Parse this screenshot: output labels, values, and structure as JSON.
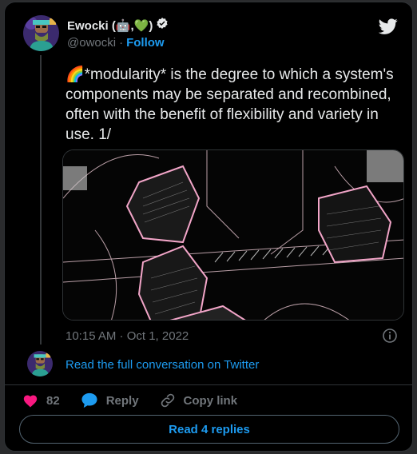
{
  "tweet": {
    "author": {
      "display_name": "Ewocki (🤖,💚)",
      "verified_icon": "verified-badge-icon",
      "handle": "@owocki",
      "separator": "·",
      "follow_label": "Follow"
    },
    "text": "🌈*modularity* is the degree to which a system's components may be separated and recombined, often with the benefit of flexibility and variety in use. 1/",
    "timestamp": "10:15 AM · Oct 1, 2022",
    "read_conversation": "Read the full conversation on Twitter",
    "likes_count": "82",
    "reply_label": "Reply",
    "copy_link_label": "Copy link",
    "read_replies_label": "Read 4 replies"
  },
  "colors": {
    "accent": "#1d9bf0",
    "like": "#f91880",
    "muted": "#71767b",
    "background": "#000000"
  }
}
